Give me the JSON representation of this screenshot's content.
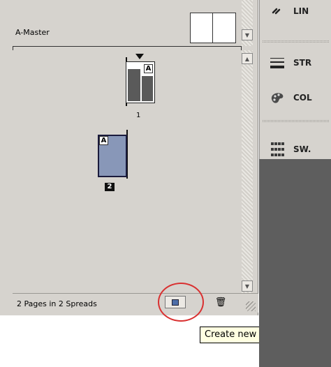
{
  "pages_panel": {
    "master_label": "A-Master",
    "pages": [
      {
        "prefix": "A",
        "number": "1"
      },
      {
        "prefix": "A",
        "number": "2"
      }
    ],
    "status_text": "2 Pages in 2 Spreads",
    "icons": {
      "new_page": "new-page-icon",
      "delete_page": "trash-icon"
    }
  },
  "tooltip": {
    "text": "Create new page"
  },
  "right_panels": [
    {
      "label": "LIN",
      "icon": "links-icon"
    },
    {
      "label": "STR",
      "icon": "stroke-icon"
    },
    {
      "label": "COL",
      "icon": "color-icon"
    },
    {
      "label": "SW.",
      "icon": "swatches-icon"
    }
  ],
  "colors": {
    "panel_bg": "#d6d3ce",
    "dock_bg": "#5e5e5e",
    "selected_page": "#8897b8",
    "highlight": "#d93030",
    "tooltip_bg": "#ffffe1"
  }
}
